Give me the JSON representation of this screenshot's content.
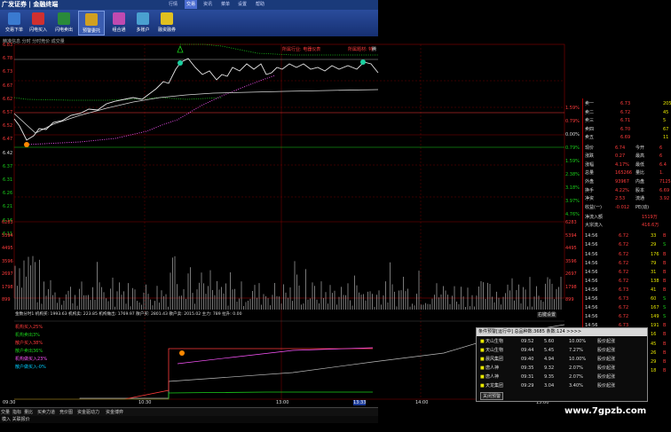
{
  "app": {
    "logo": "广发证券 | 金融终端",
    "menus": [
      "行情",
      "交易",
      "资讯",
      "菜单",
      "设置",
      "帮助"
    ]
  },
  "toolbar": [
    {
      "label": "交易下单",
      "icon": "order-icon"
    },
    {
      "label": "闪电买入",
      "icon": "flash-buy-icon"
    },
    {
      "label": "闪电卖出",
      "icon": "flash-sell-icon"
    },
    {
      "label": "预警委托",
      "icon": "alert-icon"
    },
    {
      "label": "组合通",
      "icon": "portfolio-icon"
    },
    {
      "label": "多账户",
      "icon": "multi-account-icon"
    },
    {
      "label": "融资融券",
      "icon": "margin-icon"
    }
  ],
  "chart": {
    "tabs": "精准信息  分时  分时竞价  成交量",
    "info_industry": "所属行业: 电器仪表",
    "info_concept": "所属题材: 特",
    "info_tag": "腾",
    "price_ticks": [
      "6.83",
      "6.78",
      "6.73",
      "6.67",
      "6.62",
      "6.57",
      "6.52",
      "6.47",
      "6.42",
      "6.37",
      "6.31",
      "6.26",
      "6.21",
      "6.16",
      "6.11"
    ],
    "pct_ticks": [
      "1.59%",
      "0.79%",
      "0.00%",
      "0.79%",
      "1.59%",
      "2.38%",
      "3.18%",
      "3.97%",
      "4.76%"
    ],
    "vol_ticks_left": [
      "6283",
      "5394",
      "4495",
      "3596",
      "2697",
      "1798",
      "899"
    ],
    "vol_ticks_right": [
      "6283",
      "5394",
      "4495",
      "3596",
      "2697",
      "1798",
      "899"
    ],
    "main_label": "金数分时1 机构买: 1993.63 机构卖: 223.85 机构做出: 1769.97 散户买: 2801.43 散户卖: 2015.02 主力: 789 拉升: 0.00",
    "right_btn": "右键设置",
    "flow_labels": [
      "机构买入25%",
      "机构卖出3%",
      "散户买入38%",
      "散户卖出36%",
      "机构做买入23%",
      "散户做买入-0%"
    ],
    "time_ticks": [
      "09:30",
      "10:30",
      "13:00",
      "13:33",
      "14:00",
      "15:00"
    ]
  },
  "quote": {
    "asks": [
      {
        "k": "卖一",
        "p": "6.73",
        "v": "205"
      },
      {
        "k": "卖二",
        "p": "6.72",
        "v": "45"
      },
      {
        "k": "卖三",
        "p": "6.71",
        "v": "5"
      },
      {
        "k": "卖四",
        "p": "6.70",
        "v": "67"
      },
      {
        "k": "卖五",
        "p": "6.69",
        "v": "11"
      }
    ],
    "stats": [
      {
        "k": "现价",
        "v": "6.74",
        "k2": "今开",
        "v2": "6"
      },
      {
        "k": "涨跌",
        "v": "0.27",
        "k2": "最高",
        "v2": "6"
      },
      {
        "k": "涨幅",
        "v": "4.17%",
        "k2": "最低",
        "v2": "6.4"
      },
      {
        "k": "总量",
        "v": "165266",
        "k2": "量比",
        "v2": "1."
      },
      {
        "k": "外盘",
        "v": "93967",
        "k2": "内盘",
        "v2": "7125"
      },
      {
        "k": "换手",
        "v": "4.22%",
        "k2": "股本",
        "v2": "6.69"
      },
      {
        "k": "净资",
        "v": "2.53",
        "k2": "流通",
        "v2": "3.92"
      },
      {
        "k": "收益(一)",
        "v": "-0.012",
        "k2": "PE(动)",
        "v2": ""
      }
    ],
    "flows": [
      {
        "k": "净流入额",
        "v": "1519万"
      },
      {
        "k": "大宗流入",
        "v": "416.6万"
      }
    ],
    "ticks": [
      {
        "t": "14:56",
        "p": "6.72",
        "v": "33",
        "d": "B"
      },
      {
        "t": "14:56",
        "p": "6.72",
        "v": "29",
        "d": "S"
      },
      {
        "t": "14:56",
        "p": "6.72",
        "v": "176",
        "d": "B"
      },
      {
        "t": "14:56",
        "p": "6.72",
        "v": "79",
        "d": "B"
      },
      {
        "t": "14:56",
        "p": "6.72",
        "v": "31",
        "d": "B"
      },
      {
        "t": "14:56",
        "p": "6.72",
        "v": "138",
        "d": "B"
      },
      {
        "t": "14:56",
        "p": "6.73",
        "v": "41",
        "d": "B"
      },
      {
        "t": "14:56",
        "p": "6.73",
        "v": "60",
        "d": "S"
      },
      {
        "t": "14:56",
        "p": "6.72",
        "v": "167",
        "d": "S"
      },
      {
        "t": "14:56",
        "p": "6.72",
        "v": "149",
        "d": "S"
      },
      {
        "t": "14:56",
        "p": "6.73",
        "v": "191",
        "d": "B"
      },
      {
        "t": "14:56",
        "p": "6.73",
        "v": "16",
        "d": "B"
      },
      {
        "t": "14:57",
        "p": "6.73",
        "v": "45",
        "d": "B"
      },
      {
        "t": "14:57",
        "p": "6.73",
        "v": "26",
        "d": "B"
      },
      {
        "t": "14:57",
        "p": "6.73",
        "v": "29",
        "d": "B"
      },
      {
        "t": "15:00",
        "p": "6.74",
        "v": "18",
        "d": "B"
      }
    ]
  },
  "popup": {
    "header": "条件预警[运行中] 总品种数:3685 条数:124  >>>>",
    "rows": [
      {
        "name": "天山生物",
        "time": "09:52",
        "price": "5.60",
        "pct": "10.00%",
        "sig": "股价起涨"
      },
      {
        "name": "天山生物",
        "time": "09:44",
        "price": "5.45",
        "pct": "7.27%",
        "sig": "股价起涨"
      },
      {
        "name": "晨风集团",
        "time": "09:40",
        "price": "4.94",
        "pct": "10.00%",
        "sig": "股价起涨"
      },
      {
        "name": "唐人神",
        "time": "09:35",
        "price": "9.32",
        "pct": "2.07%",
        "sig": "股价起涨"
      },
      {
        "name": "唐人神",
        "time": "09:31",
        "price": "9.35",
        "pct": "2.07%",
        "sig": "股价起涨"
      },
      {
        "name": "天龙集团",
        "time": "09:29",
        "price": "3.04",
        "pct": "3.40%",
        "sig": "股价起涨"
      }
    ],
    "close": "关闭预警"
  },
  "bottom": {
    "tabs": [
      "交量",
      "指标",
      "量比",
      "买卖力道",
      "竞价图",
      "资金驱动力",
      "资金博弈"
    ],
    "status": "模入  关联报价"
  },
  "watermark": "www.7gpzb.com"
}
